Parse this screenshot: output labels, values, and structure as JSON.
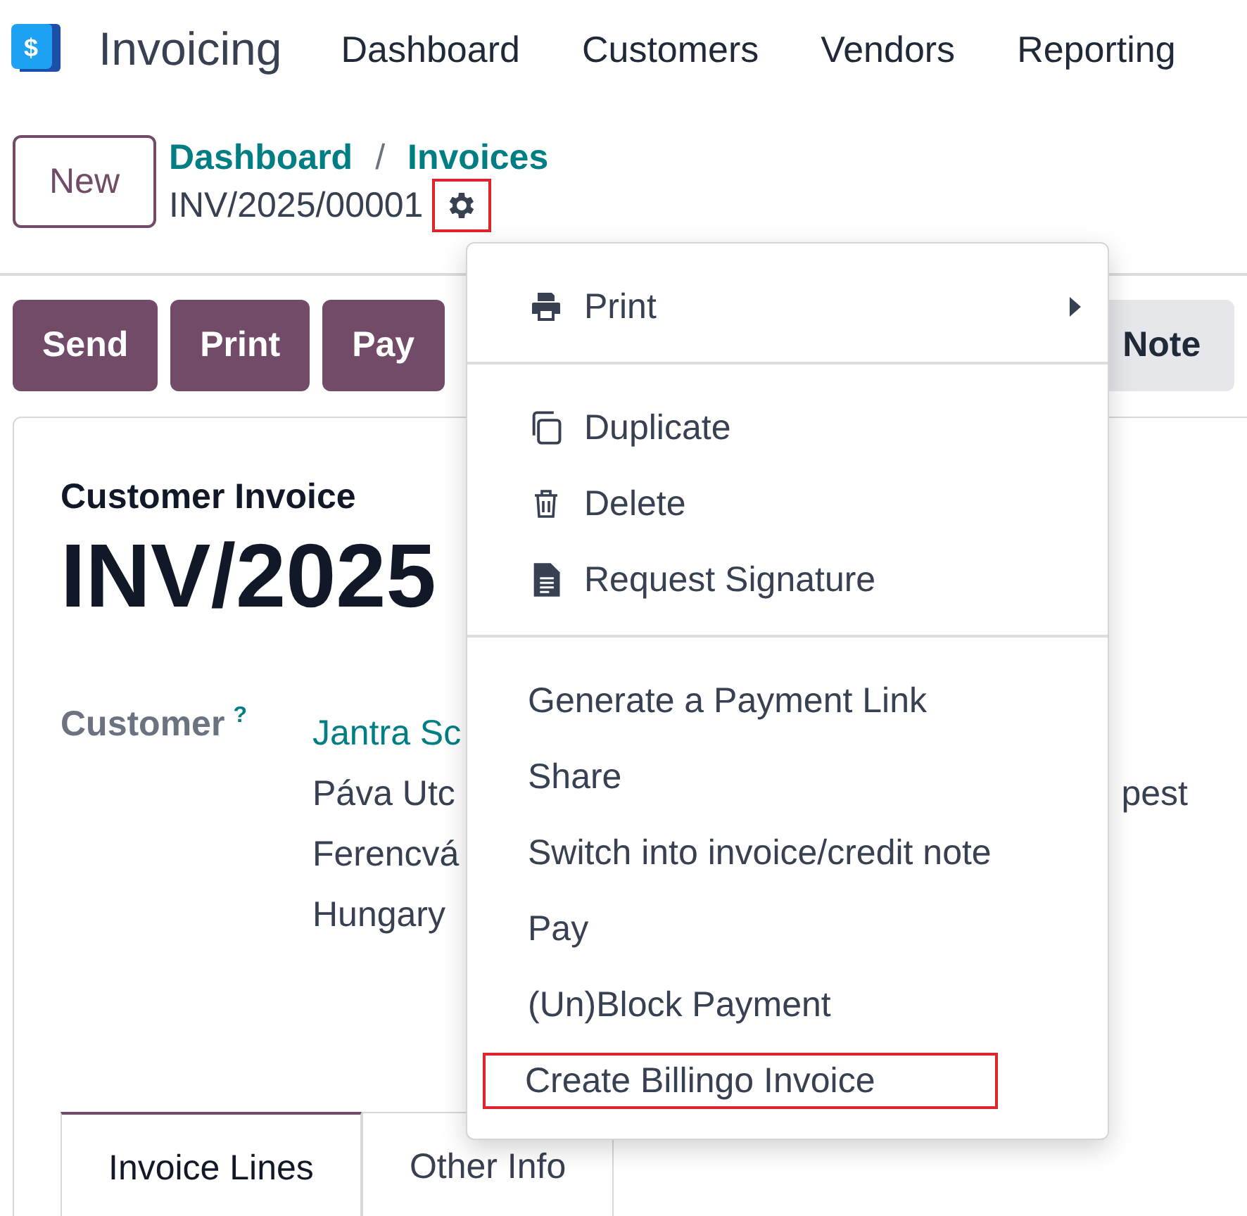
{
  "app": {
    "name": "Invoicing",
    "logo_text": "$"
  },
  "nav": [
    "Dashboard",
    "Customers",
    "Vendors",
    "Reporting"
  ],
  "new_button": "New",
  "breadcrumb": [
    "Dashboard",
    "Invoices"
  ],
  "breadcrumb_separator": "/",
  "record_name": "INV/2025/00001",
  "gear_highlighted": true,
  "action_buttons": [
    {
      "label": "Send",
      "kind": "primary"
    },
    {
      "label": "Print",
      "kind": "primary"
    },
    {
      "label": "Pay",
      "kind": "primary"
    },
    {
      "label": "Note",
      "kind": "secondary"
    }
  ],
  "form": {
    "type_label": "Customer Invoice",
    "number": "INV/2025",
    "customer_label": "Customer",
    "help_mark": "?",
    "customer_name": "Jantra Sc",
    "address_lines": [
      "Páva Utc",
      "Ferencvá",
      "Hungary"
    ],
    "address_right": "pest"
  },
  "tabs": [
    {
      "label": "Invoice Lines",
      "selected": true
    },
    {
      "label": "Other Info",
      "selected": false
    }
  ],
  "menu": {
    "sections": [
      [
        {
          "label": "Print",
          "kind": "printer",
          "submenu": true,
          "highlighted": false
        }
      ],
      [
        {
          "label": "Duplicate",
          "kind": "copy",
          "submenu": false,
          "highlighted": false
        },
        {
          "label": "Delete",
          "kind": "trash",
          "submenu": false,
          "highlighted": false
        },
        {
          "label": "Request Signature",
          "kind": "document",
          "submenu": false,
          "highlighted": false
        }
      ],
      [
        {
          "label": "Generate a Payment Link",
          "kind": "plain",
          "submenu": false,
          "highlighted": false
        },
        {
          "label": "Share",
          "kind": "plain",
          "submenu": false,
          "highlighted": false
        },
        {
          "label": "Switch into invoice/credit note",
          "kind": "plain",
          "submenu": false,
          "highlighted": false
        },
        {
          "label": "Pay",
          "kind": "plain",
          "submenu": false,
          "highlighted": false
        },
        {
          "label": "(Un)Block Payment",
          "kind": "plain",
          "submenu": false,
          "highlighted": false
        },
        {
          "label": "Create Billingo Invoice",
          "kind": "plain",
          "submenu": false,
          "highlighted": true
        }
      ]
    ]
  }
}
